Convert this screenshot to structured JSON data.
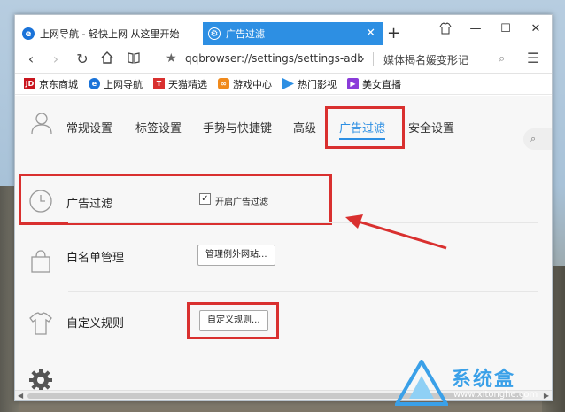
{
  "tabs": [
    {
      "label": "上网导航 - 轻快上网 从这里开始",
      "active": false
    },
    {
      "label": "广告过滤",
      "active": true
    }
  ],
  "toolbar": {
    "url": "qqbrowser://settings/settings-adblc",
    "search_text": "媒体揭名媛变形记"
  },
  "bookmarks": [
    {
      "label": "京东商城",
      "icon": "jd-icon",
      "color": "#c9151e"
    },
    {
      "label": "上网导航",
      "icon": "ie-icon",
      "color": "#1a73d9"
    },
    {
      "label": "天猫精选",
      "icon": "tmall-icon",
      "color": "#d9302f"
    },
    {
      "label": "游戏中心",
      "icon": "game-icon",
      "color": "#f08a1c"
    },
    {
      "label": "热门影视",
      "icon": "video-icon",
      "color": "#2d8fe3"
    },
    {
      "label": "美女直播",
      "icon": "live-icon",
      "color": "#8a3bd9"
    }
  ],
  "settings_tabs": [
    {
      "label": "常规设置"
    },
    {
      "label": "标签设置"
    },
    {
      "label": "手势与快捷键"
    },
    {
      "label": "高级"
    },
    {
      "label": "广告过滤",
      "active": true
    },
    {
      "label": "安全设置"
    }
  ],
  "rows": {
    "adblock": {
      "label": "广告过滤",
      "checkbox_label": "开启广告过滤",
      "checked": true
    },
    "whitelist": {
      "label": "白名单管理",
      "button": "管理例外网站..."
    },
    "custom": {
      "label": "自定义规则",
      "button": "自定义规则..."
    }
  },
  "watermark": {
    "text": "系统盒",
    "url": "www.xitonghe.com"
  },
  "colors": {
    "accent": "#2d8fe3",
    "highlight": "#d9302f"
  }
}
